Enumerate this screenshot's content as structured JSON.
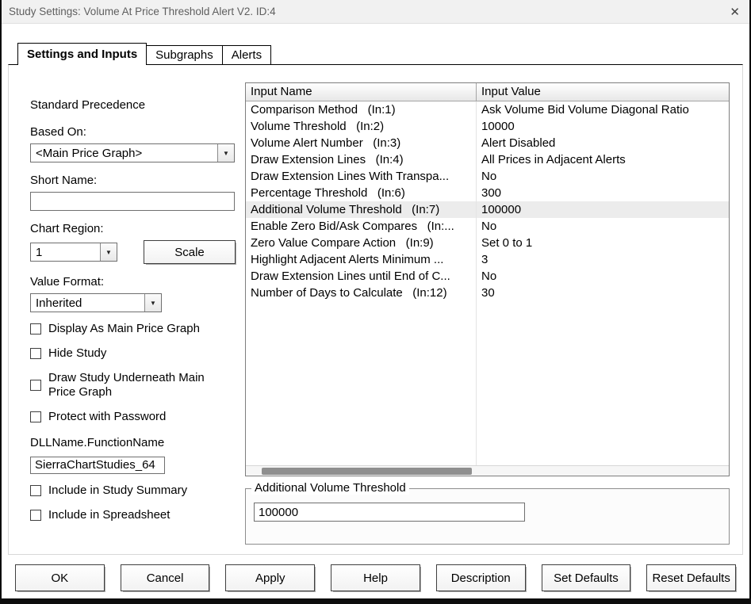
{
  "window": {
    "title": "Study Settings: Volume At Price Threshold Alert V2. ID:4",
    "close_glyph": "✕"
  },
  "tabs": [
    {
      "label": "Settings and Inputs",
      "active": true
    },
    {
      "label": "Subgraphs",
      "active": false
    },
    {
      "label": "Alerts",
      "active": false
    }
  ],
  "left_panel": {
    "precedence_label": "Standard Precedence",
    "based_on": {
      "label": "Based On:",
      "value": "<Main Price Graph>"
    },
    "short_name": {
      "label": "Short Name:",
      "value": ""
    },
    "chart_region": {
      "label": "Chart Region:",
      "value": "1",
      "scale_button": "Scale"
    },
    "value_format": {
      "label": "Value Format:",
      "value": "Inherited"
    },
    "display_checkboxes": [
      {
        "label": "Display As Main Price Graph",
        "checked": false
      },
      {
        "label": "Hide Study",
        "checked": false
      },
      {
        "label": "Draw Study Underneath Main Price Graph",
        "checked": false
      },
      {
        "label": "Protect with Password",
        "checked": false
      }
    ],
    "dll": {
      "label": "DLLName.FunctionName",
      "value": "SierraChartStudies_64"
    },
    "include_checkboxes": [
      {
        "label": "Include in Study Summary",
        "checked": false
      },
      {
        "label": "Include in Spreadsheet",
        "checked": false
      }
    ]
  },
  "inputs_table": {
    "columns": [
      "Input Name",
      "Input Value"
    ],
    "rows": [
      {
        "name": "Comparison Method   (In:1)",
        "value": "Ask Volume Bid Volume Diagonal Ratio",
        "selected": false
      },
      {
        "name": "Volume Threshold   (In:2)",
        "value": "10000",
        "selected": false
      },
      {
        "name": "Volume Alert Number   (In:3)",
        "value": "Alert Disabled",
        "selected": false
      },
      {
        "name": "Draw Extension Lines   (In:4)",
        "value": "All Prices in Adjacent Alerts",
        "selected": false
      },
      {
        "name": "Draw Extension Lines With Transpa...",
        "value": "No",
        "selected": false
      },
      {
        "name": "Percentage Threshold   (In:6)",
        "value": "300",
        "selected": false
      },
      {
        "name": "Additional Volume Threshold   (In:7)",
        "value": "100000",
        "selected": true
      },
      {
        "name": "Enable Zero Bid/Ask Compares   (In:...",
        "value": "No",
        "selected": false
      },
      {
        "name": "Zero Value Compare Action   (In:9)",
        "value": "Set 0 to 1",
        "selected": false
      },
      {
        "name": "Highlight Adjacent Alerts Minimum ...",
        "value": "3",
        "selected": false
      },
      {
        "name": "Draw Extension Lines until End of C...",
        "value": "No",
        "selected": false
      },
      {
        "name": "Number of Days to Calculate   (In:12)",
        "value": "30",
        "selected": false
      }
    ],
    "empty_row_count": 10
  },
  "detail_box": {
    "title": "Additional Volume Threshold",
    "value": "100000"
  },
  "footer_buttons": [
    "OK",
    "Cancel",
    "Apply",
    "Help",
    "Description",
    "Set Defaults",
    "Reset Defaults"
  ]
}
